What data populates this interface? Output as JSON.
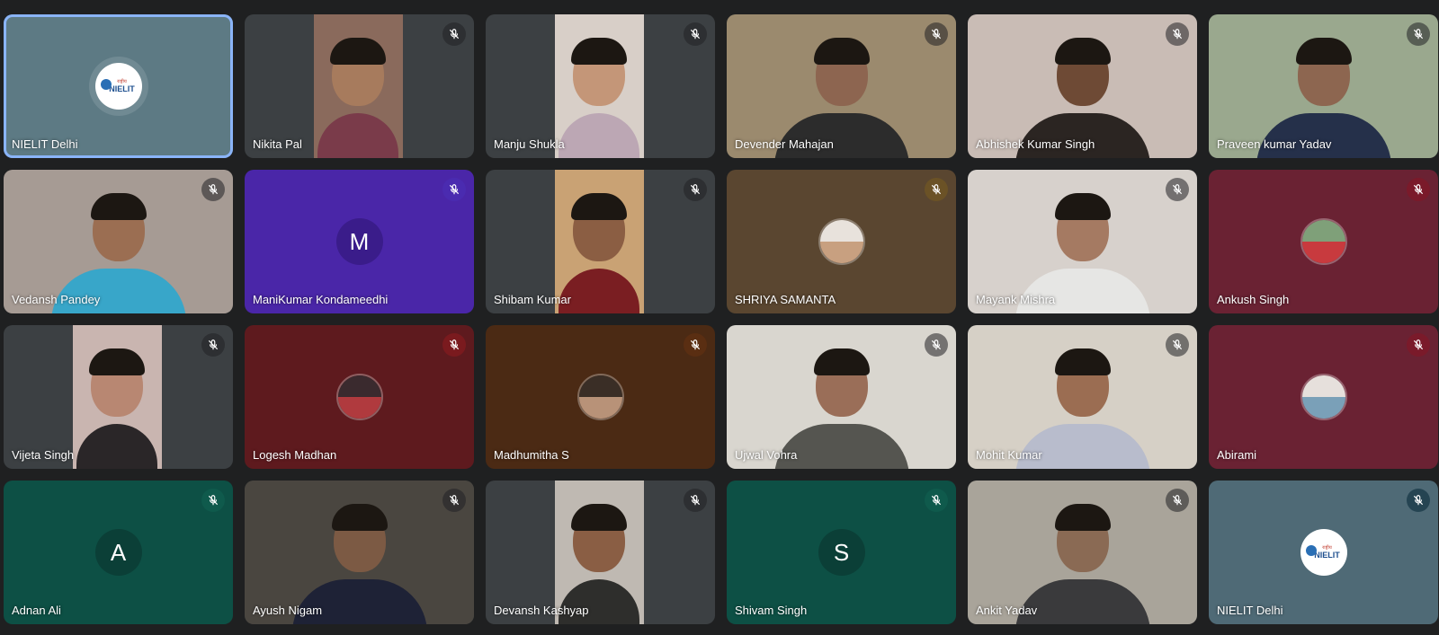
{
  "participants": [
    {
      "name": "NIELIT Delhi",
      "tile": "#5d7a84",
      "kind": "logo",
      "speaking": true,
      "mic": false,
      "logo_top": "राष्ट्रीय",
      "logo_text": "NIELIT"
    },
    {
      "name": "Nikita Pal",
      "tile": "#3c4043",
      "kind": "narrow",
      "bg": "#8a6a5c",
      "shirt": "#7a3b4a",
      "skin": "#a77b5d"
    },
    {
      "name": "Manju Shukla",
      "tile": "#3c4043",
      "kind": "narrow",
      "bg": "#d8cfc8",
      "shirt": "#bca7b4",
      "skin": "#c49678"
    },
    {
      "name": "Devender Mahajan",
      "tile": "#3c4043",
      "kind": "full",
      "bg": "#9b8a6e",
      "shirt": "#2c2c2c",
      "skin": "#8d6550"
    },
    {
      "name": "Abhishek Kumar Singh",
      "tile": "#3c4043",
      "kind": "full",
      "bg": "#c9bcb5",
      "shirt": "#2b2522",
      "skin": "#6e4a35"
    },
    {
      "name": "Praveen kumar Yadav",
      "tile": "#3c4043",
      "kind": "full",
      "bg": "#9aa88e",
      "shirt": "#25304a",
      "skin": "#8d6650"
    },
    {
      "name": "Vedansh Pandey",
      "tile": "#3c4043",
      "kind": "full",
      "bg": "#a69b94",
      "shirt": "#38a6c9",
      "skin": "#9b6e52"
    },
    {
      "name": "ManiKumar Kondameedhi",
      "tile": "#4a26a8",
      "kind": "letter",
      "letter": "M",
      "avatar": "#3a1c8a",
      "mic_color": "#4a2bb0"
    },
    {
      "name": "Shibam Kumar",
      "tile": "#3c4043",
      "kind": "narrow",
      "bg": "#c9a274",
      "shirt": "#7a1e22",
      "skin": "#8b5e43"
    },
    {
      "name": "SHRIYA SAMANTA",
      "tile": "#5a4630",
      "kind": "photo",
      "photo_top": "#e8e2dc",
      "photo_bot": "#c8a080",
      "mic_color": "#6b5226"
    },
    {
      "name": "Mayank Mishra",
      "tile": "#3c4043",
      "kind": "full",
      "bg": "#d7d1cc",
      "shirt": "#e6e6e4",
      "skin": "#a57a62"
    },
    {
      "name": "Ankush Singh",
      "tile": "#6a2233",
      "kind": "photo",
      "photo_top": "#7fa079",
      "photo_bot": "#c83a3e",
      "mic_color": "#7a1a2a"
    },
    {
      "name": "Vijeta Singh",
      "tile": "#3c4043",
      "kind": "narrow",
      "bg": "#c9b5b0",
      "shirt": "#2a2628",
      "skin": "#b88772"
    },
    {
      "name": "Logesh Madhan",
      "tile": "#5e1a1e",
      "kind": "photo",
      "photo_top": "#3a2a2e",
      "photo_bot": "#b03a3e",
      "mic_color": "#7a1a1e"
    },
    {
      "name": "Madhumitha S",
      "tile": "#4b2a14",
      "kind": "photo",
      "photo_top": "#3a2e26",
      "photo_bot": "#b89278",
      "mic_color": "#5a2e12"
    },
    {
      "name": "Ujwal Vohra",
      "tile": "#3c4043",
      "kind": "full",
      "bg": "#d9d6cf",
      "shirt": "#555550",
      "skin": "#9a6e58"
    },
    {
      "name": "Mohit Kumar",
      "tile": "#3c4043",
      "kind": "full",
      "bg": "#d6d0c6",
      "shirt": "#b8bccc",
      "skin": "#9b6d52"
    },
    {
      "name": "Abirami",
      "tile": "#6a2233",
      "kind": "photo",
      "photo_top": "#e6e0dc",
      "photo_bot": "#7aa0b8",
      "mic_color": "#7a1a2a"
    },
    {
      "name": "Adnan Ali",
      "tile": "#0d5045",
      "kind": "letter",
      "letter": "A",
      "avatar": "#0b3f37",
      "mic_color": "#0f5a4c"
    },
    {
      "name": "Ayush Nigam",
      "tile": "#3c4043",
      "kind": "full",
      "bg": "#4a4640",
      "shirt": "#1e2236",
      "skin": "#7c5a44"
    },
    {
      "name": "Devansh Kashyap",
      "tile": "#3c4043",
      "kind": "narrow",
      "bg": "#bfb9b2",
      "shirt": "#2e2e2c",
      "skin": "#8a5e44"
    },
    {
      "name": "Shivam Singh",
      "tile": "#0d5045",
      "kind": "letter",
      "letter": "S",
      "avatar": "#0b3f37",
      "mic_color": "#0f5a4c"
    },
    {
      "name": "Ankit Yadav",
      "tile": "#3c4043",
      "kind": "full",
      "bg": "#a9a49a",
      "shirt": "#3a3a3c",
      "skin": "#8a6a54"
    },
    {
      "name": "NIELIT Delhi",
      "tile": "#4f6a76",
      "kind": "logo",
      "mic_color": "#254452",
      "logo_top": "राष्ट्रीय",
      "logo_text": "NIELIT"
    }
  ]
}
